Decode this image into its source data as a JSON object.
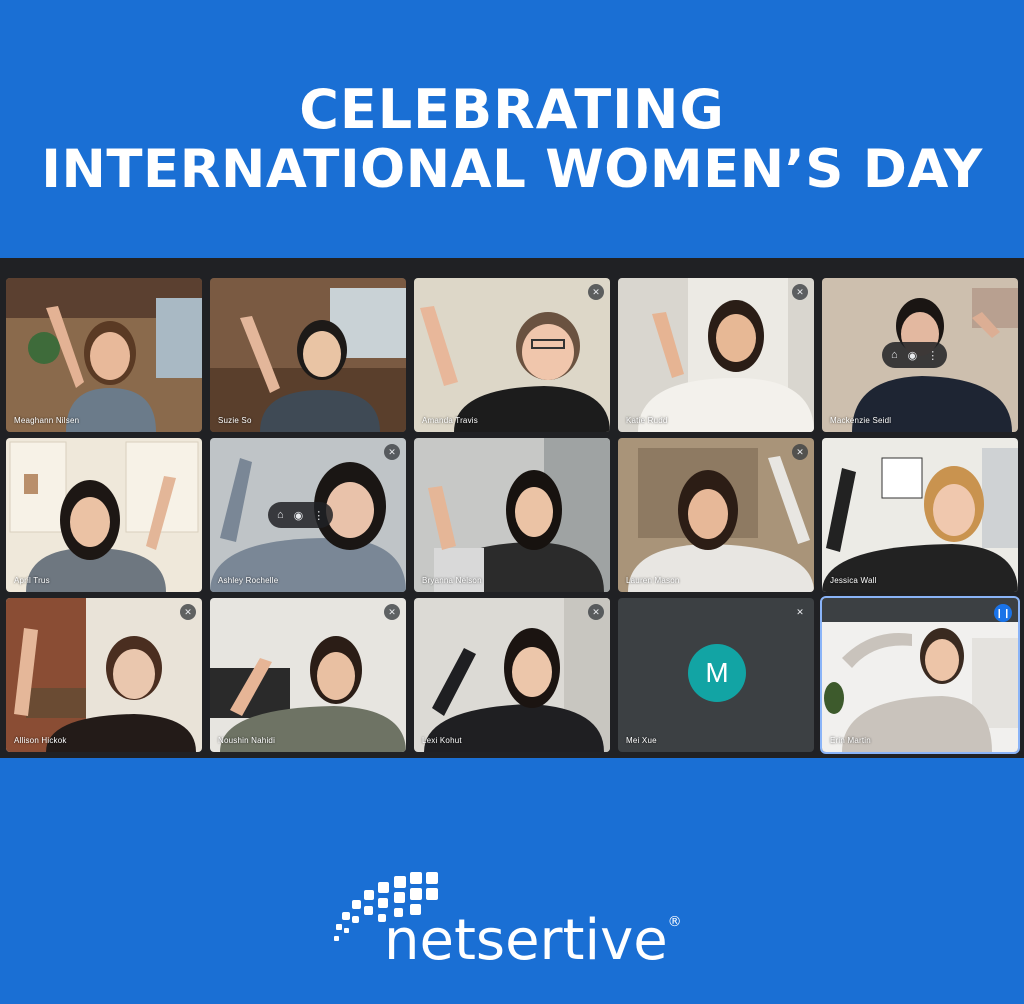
{
  "headline": {
    "line1": "CELEBRATING",
    "line2": "INTERNATIONAL WOMEN’S DAY"
  },
  "brand": {
    "name": "netsertive",
    "registered_mark": "®"
  },
  "colors": {
    "background": "#1a6fd4",
    "meeting_bg": "#202124",
    "avatar_teal": "#12a4a4",
    "speaking_blue": "#1a73e8"
  },
  "participants": [
    {
      "name": "Meaghann Nilsen"
    },
    {
      "name": "Suzie So"
    },
    {
      "name": "Amanda Travis",
      "icon": "mic-off-icon"
    },
    {
      "name": "Katie Rudd",
      "icon": "mic-off-icon"
    },
    {
      "name": "Mackenzie Seidl"
    },
    {
      "name": "April Trus"
    },
    {
      "name": "Ashley Rochelle",
      "icon": "mic-off-icon"
    },
    {
      "name": "Bryanna Nelson"
    },
    {
      "name": "Lauren Mason",
      "icon": "mic-off-icon"
    },
    {
      "name": "Jessica Wall"
    },
    {
      "name": "Allison Hickok",
      "icon": "mic-off-icon"
    },
    {
      "name": "Noushin Nahidi",
      "icon": "mic-off-icon"
    },
    {
      "name": "Lexi Kohut",
      "icon": "mic-off-icon"
    },
    {
      "name": "Mei Xue",
      "icon": "mic-off-icon",
      "avatar_initial": "M"
    },
    {
      "name": "Erin Martin",
      "icon": "speaking-indicator-icon"
    }
  ]
}
